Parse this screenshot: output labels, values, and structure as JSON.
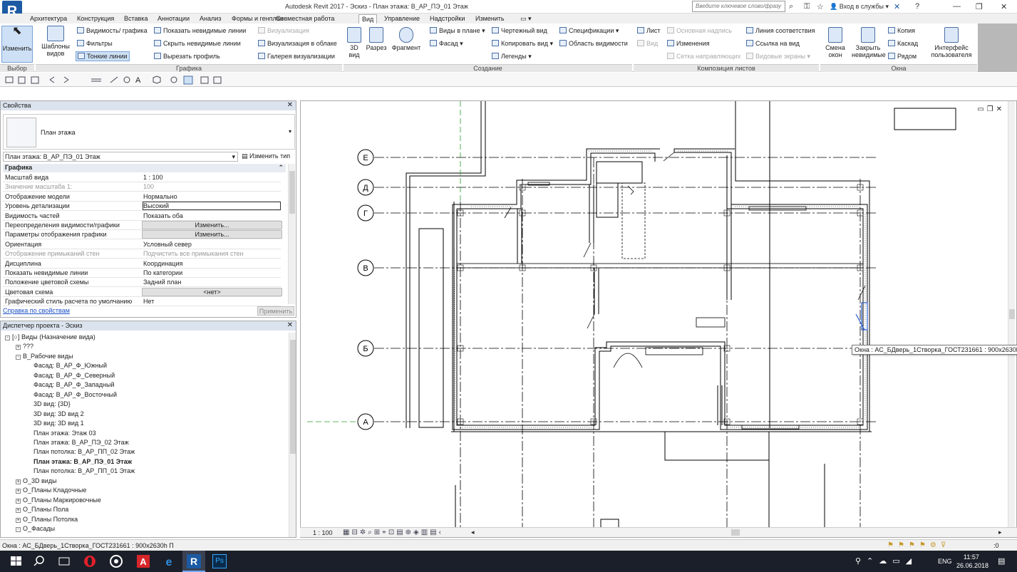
{
  "window": {
    "title": "Autodesk Revit 2017 -    Эскиз - План этажа: В_АР_ПЭ_01 Этаж",
    "search_placeholder": "Введите ключевое слово/фразу",
    "signin": "Вход в службы"
  },
  "logo": "R",
  "tabs": [
    "Архитектура",
    "Конструкция",
    "Вставка",
    "Аннотации",
    "Анализ",
    "Формы и генплан",
    "Совместная работа",
    "Вид",
    "Управление",
    "Надстройки",
    "Изменить"
  ],
  "active_tab": "Вид",
  "ribbon": {
    "modify": "Изменить",
    "templates": "Шаблоны видов",
    "vis_graphics": "Видимость/ графика",
    "filters": "Фильтры",
    "thin_lines": "Тонкие линии",
    "show_hidden": "Показать невидимые линии",
    "hide_hidden": "Скрыть невидимые линии",
    "cut_profile": "Вырезать профиль",
    "render": "Визуализация",
    "render_cloud": "Визуализация в облаке",
    "render_gallery": "Галерея визуализации",
    "view3d": "3D вид",
    "section": "Разрез",
    "callout": "Фрагмент",
    "plan_views": "Виды в плане",
    "elevation": "Фасад",
    "drafting": "Чертежный вид",
    "duplicate": "Копировать вид",
    "legends": "Легенды",
    "schedules": "Спецификации",
    "scope_box": "Область видимости",
    "sheet": "Лист",
    "view": "Вид",
    "title_block": "Основная надпись",
    "revisions": "Изменения",
    "guide_grid": "Сетка направляющих",
    "matchline": "Линия соответствия",
    "view_ref": "Ссылка на вид",
    "viewports": "Видовые экраны",
    "switch_windows": "Смена окон",
    "close_hidden": "Закрыть невидимые",
    "replicate": "Копия",
    "cascade": "Каскад",
    "tile": "Рядом",
    "user_interface": "Интерфейс пользователя",
    "groups": {
      "select": "Выбор",
      "graphics": "Графика",
      "create": "Создание",
      "sheet_comp": "Композиция листов",
      "windows": "Окна"
    }
  },
  "properties": {
    "header": "Свойства",
    "type_name": "План этажа",
    "selector": "План этажа: В_АР_ПЭ_01 Этаж",
    "edit_type": "Изменить тип",
    "section": "Графика",
    "rows": [
      {
        "k": "Масштаб вида",
        "v": "1 : 100"
      },
      {
        "k": "Значение масштаба    1:",
        "v": "100"
      },
      {
        "k": "Отображение модели",
        "v": "Нормально"
      },
      {
        "k": "Уровень детализации",
        "v": "Высокий"
      },
      {
        "k": "Видимость частей",
        "v": "Показать оба"
      },
      {
        "k": "Переопределения видимости/графики",
        "v": "Изменить..."
      },
      {
        "k": "Параметры отображения графики",
        "v": "Изменить..."
      },
      {
        "k": "Ориентация",
        "v": "Условный север"
      },
      {
        "k": "Отображение примыканий стен",
        "v": "Подчистить все примыкания стен"
      },
      {
        "k": "Дисциплина",
        "v": "Координация"
      },
      {
        "k": "Показать невидимые линии",
        "v": "По категории"
      },
      {
        "k": "Положение цветовой схемы",
        "v": "Задний план"
      },
      {
        "k": "Цветовая схема",
        "v": "<нет>"
      },
      {
        "k": "Графический стиль расчета по умолчанию",
        "v": "Нет"
      }
    ],
    "help": "Справка по свойствам",
    "apply": "Применить"
  },
  "browser": {
    "header": "Диспетчер проекта - Эскиз",
    "nodes": [
      {
        "t": "[○] Виды (Назначение вида)",
        "lvl": 0,
        "exp": "-"
      },
      {
        "t": "???",
        "lvl": 1,
        "exp": "+"
      },
      {
        "t": "В_Рабочие виды",
        "lvl": 1,
        "exp": "-"
      },
      {
        "t": "Фасад: В_АР_Ф_Южный",
        "lvl": 2
      },
      {
        "t": "Фасад: В_АР_Ф_Северный",
        "lvl": 2
      },
      {
        "t": "Фасад: В_АР_Ф_Западный",
        "lvl": 2
      },
      {
        "t": "Фасад: В_АР_Ф_Восточный",
        "lvl": 2
      },
      {
        "t": "3D вид: {3D}",
        "lvl": 2
      },
      {
        "t": "3D вид: 3D вид 2",
        "lvl": 2
      },
      {
        "t": "3D вид: 3D вид 1",
        "lvl": 2
      },
      {
        "t": "План этажа: Этаж 03",
        "lvl": 2
      },
      {
        "t": "План этажа: В_АР_ПЭ_02 Этаж",
        "lvl": 2
      },
      {
        "t": "План потолка: В_АР_ПП_02 Этаж",
        "lvl": 2
      },
      {
        "t": "План этажа: В_АР_ПЭ_01 Этаж",
        "lvl": 2,
        "bold": true
      },
      {
        "t": "План потолка: В_АР_ПП_01 Этаж",
        "lvl": 2
      },
      {
        "t": "О_3D виды",
        "lvl": 1,
        "exp": "+"
      },
      {
        "t": "О_Планы Кладочные",
        "lvl": 1,
        "exp": "+"
      },
      {
        "t": "О_Планы Маркировочные",
        "lvl": 1,
        "exp": "+"
      },
      {
        "t": "О_Планы Пола",
        "lvl": 1,
        "exp": "+"
      },
      {
        "t": "О_Планы Потолка",
        "lvl": 1,
        "exp": "+"
      },
      {
        "t": "О_Фасады",
        "lvl": 1,
        "exp": "-"
      }
    ]
  },
  "grids": [
    "Е",
    "Д",
    "Г",
    "В",
    "Б",
    "А"
  ],
  "view_scale": "1 : 100",
  "tooltip": "Окна : АС_БДверь_1Створка_ГОСТ231661 : 900x2630h П",
  "status": "Окна : АС_БДверь_1Створка_ГОСТ231661 : 900x2630h П",
  "taskbar": {
    "lang": "ENG",
    "time": "11:57",
    "date": "26.06.2018"
  }
}
